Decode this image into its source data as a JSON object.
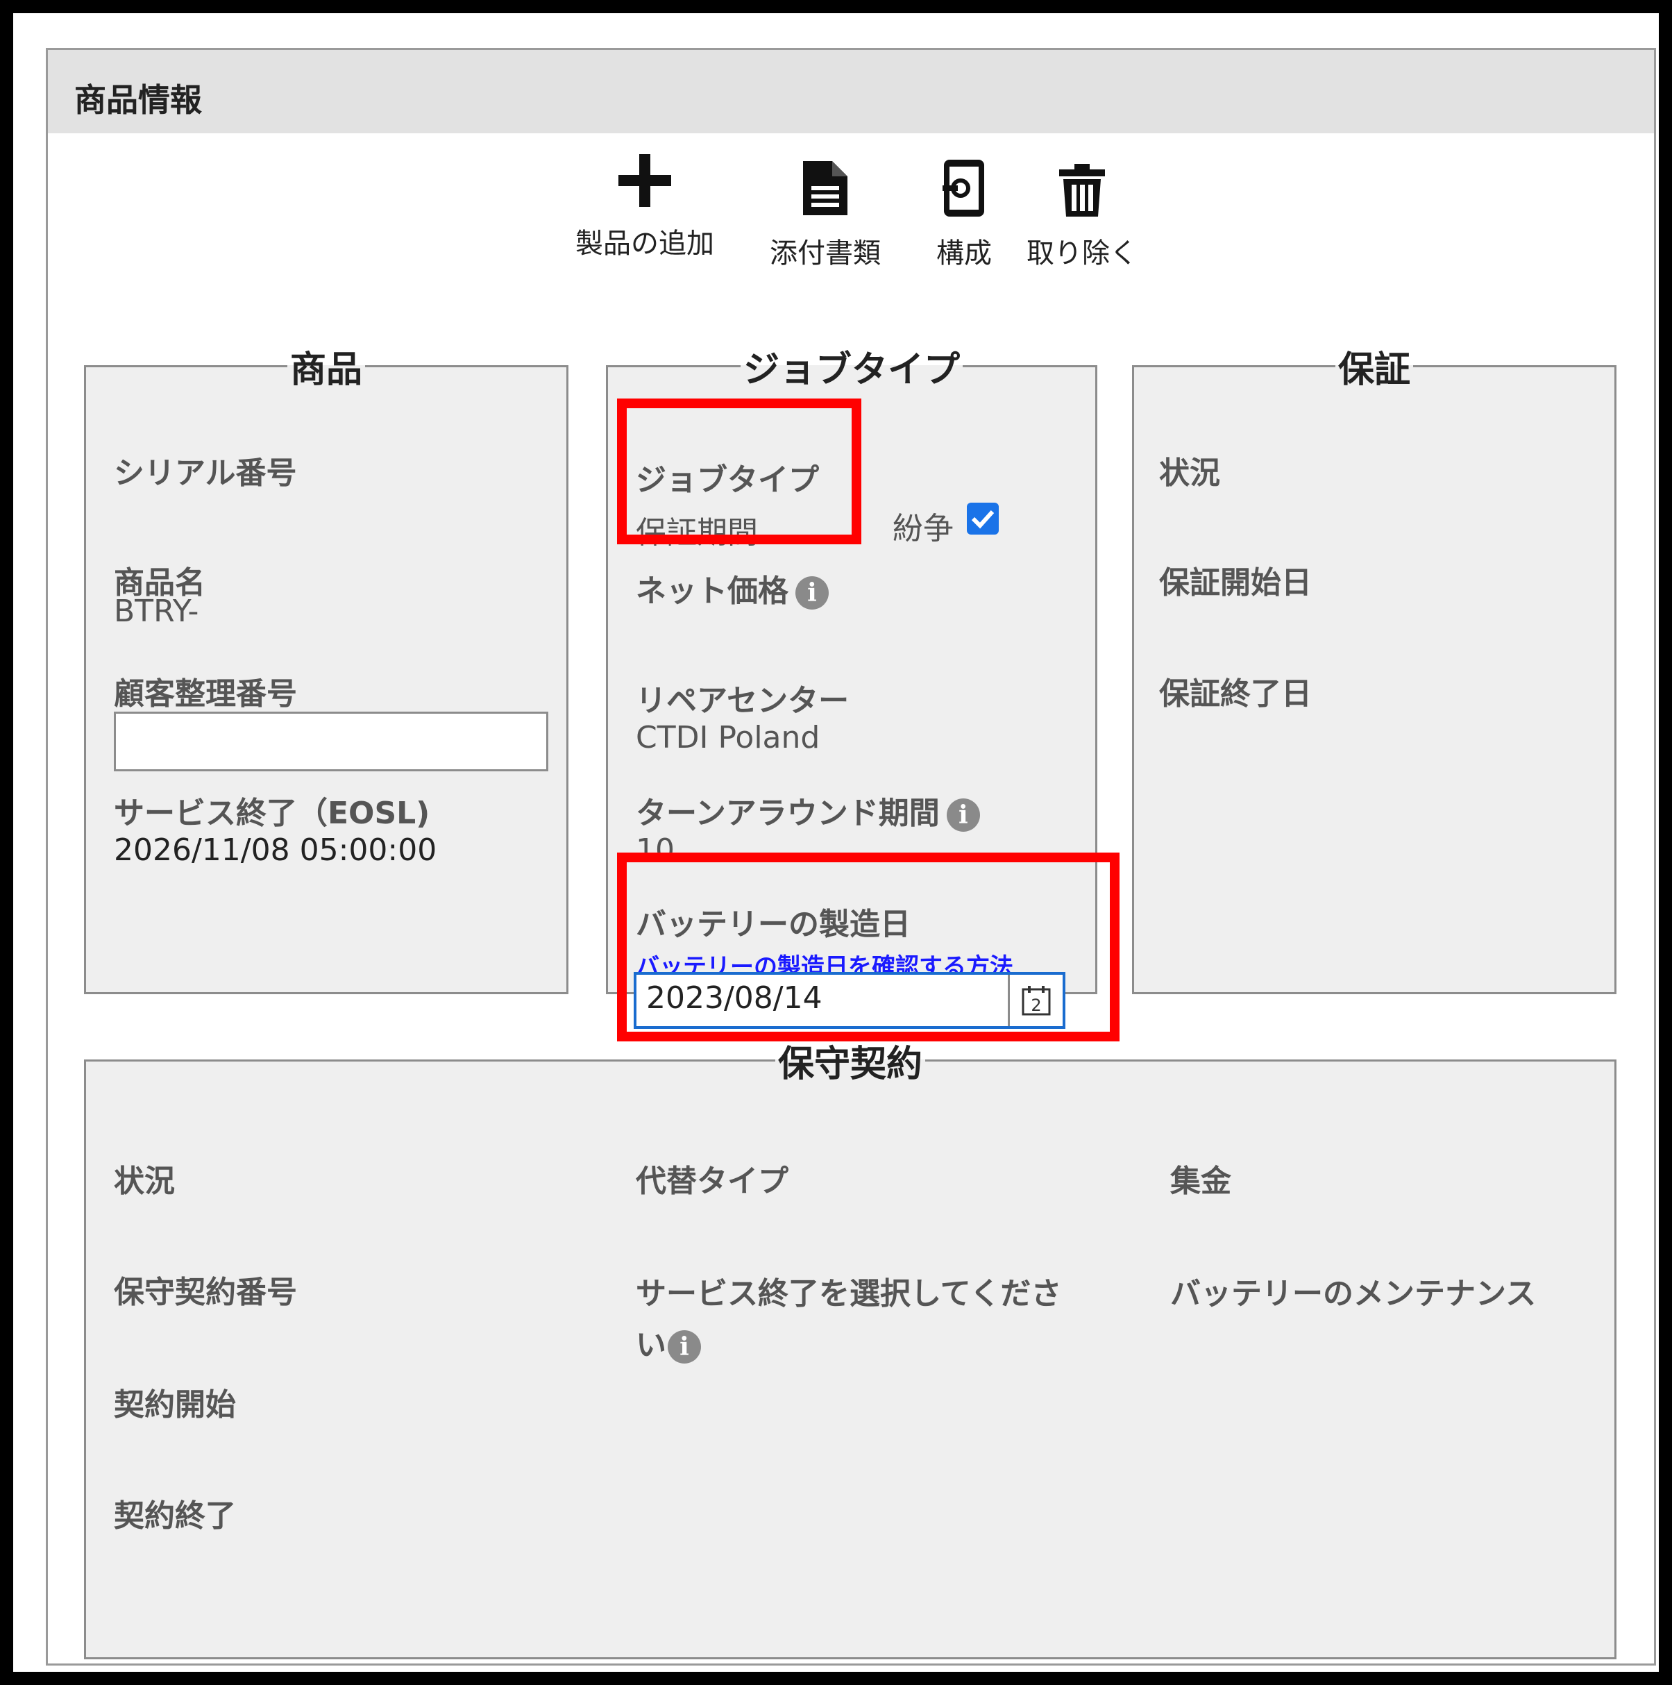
{
  "panel": {
    "title": "商品情報"
  },
  "toolbar": {
    "add_product": "製品の追加",
    "attachments": "添付書類",
    "configuration": "構成",
    "remove": "取り除く"
  },
  "product": {
    "legend": "商品",
    "serial_label": "シリアル番号",
    "product_name_label": "商品名",
    "product_name_value": "BTRY-",
    "customer_ref_label": "顧客整理番号",
    "customer_ref_value": "",
    "eosl_label": "サービス終了（EOSL)",
    "eosl_value": "2026/11/08 05:00:00"
  },
  "jobtype": {
    "legend": "ジョブタイプ",
    "jobtype_label": "ジョブタイプ",
    "jobtype_value": "保証期間",
    "dispute_label": "紛争",
    "dispute_checked": true,
    "net_price_label": "ネット価格",
    "repair_center_label": "リペアセンター",
    "repair_center_value": "CTDI Poland",
    "turnaround_label": "ターンアラウンド期間",
    "turnaround_value": "10",
    "battery_date_label": "バッテリーの製造日",
    "battery_date_link": "バッテリーの製造日を確認する方法",
    "battery_date_value": "2023/08/14",
    "calendar_day": "2"
  },
  "warranty": {
    "legend": "保証",
    "status_label": "状況",
    "start_label": "保証開始日",
    "end_label": "保証終了日"
  },
  "contract": {
    "legend": "保守契約",
    "status_label": "状況",
    "number_label": "保守契約番号",
    "start_label": "契約開始",
    "end_label": "契約終了",
    "replacement_label": "代替タイプ",
    "eosl_select_line1": "サービス終了を選択してくださ",
    "eosl_select_line2": "い",
    "collection_label": "集金",
    "battery_maintenance": "バッテリーのメンテナンス"
  },
  "colors": {
    "highlight": "#ff0000",
    "link": "#1a1aff",
    "checkbox": "#1a73e8",
    "input_border": "#1a6ccf"
  },
  "icons": [
    "plus-icon",
    "document-icon",
    "device-settings-icon",
    "trash-icon",
    "info-icon",
    "calendar-icon",
    "checkbox-checked-icon"
  ]
}
